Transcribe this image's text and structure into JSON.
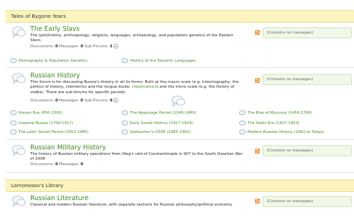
{
  "categories": [
    {
      "title": "Tales of Bygone Years"
    },
    {
      "title": "Lomonosov's Library"
    }
  ],
  "forums": [
    {
      "title": "The Early Slavs",
      "description": "The (pre)history, anthropology, religions, languages, archaeology, and population genetics of the Eastern Slavs.",
      "discussions_label": "Discussions:",
      "discussions": "0",
      "messages_label": "Messages:",
      "messages": "0",
      "subforums_label": "Sub-Forums:",
      "subforums": "2",
      "last_post": "(Contains no messages)",
      "subforum_links": [
        "Demography & Population Genetics",
        "History of the Slavonic Languages"
      ]
    },
    {
      "title": "Russian History",
      "description_a": "This forum is for discussing Russia's history in all its forms: Both at the macro scale (e.g. historiography, the politics of history, cliometrics and the longue durée, ",
      "description_link": "cliodynamics",
      "description_b": ") and the micro scale (e.g. the history of vodka). There are sub-forums for specific periods.",
      "discussions_label": "Discussions:",
      "discussions": "0",
      "messages_label": "Messages:",
      "messages": "0",
      "subforums_label": "Sub-Forums:",
      "subforums": "9",
      "last_post": "(Contains no messages)",
      "subforum_links": [
        "Kievan Rus (850-1300)",
        "The Appanage Period (1240-1480)",
        "The Rise of Muscovy (1450-1700)",
        "Imperial Russia (1700-1917)",
        "Early Soviet History (1917-1929)",
        "The Stalin Era (1927-1953)",
        "The Later Soviet Period (1953-1985)",
        "Gorbachev's USSR (1985-1991)",
        "Modern Russian History (1991 to Today)"
      ]
    },
    {
      "title": "Russian Military History",
      "description": "The history of Russian military operations from Oleg's raid of Constantinople in 907 to the South Ossetian War of 2008.",
      "discussions_label": "Discussions:",
      "discussions": "0",
      "messages_label": "Messages:",
      "messages": "0",
      "last_post": "(Contains no messages)"
    },
    {
      "title": "Russian Literature",
      "description": "Classical and modern Russian literature, with separate sections for Russian philosophy/political economy",
      "last_post": "(Contains no messages)"
    }
  ],
  "icons": {
    "forum": "speech-bubble-icon",
    "rss": "rss-feed-icon",
    "subforum": "small-speech-bubble-icon",
    "expand": "chevron-down-icon"
  },
  "colors": {
    "category_bg": "#fbf4bf",
    "link": "#3d8a1e",
    "last_post_bg": "#f1f8e9",
    "rss": "#ef8a2a"
  }
}
